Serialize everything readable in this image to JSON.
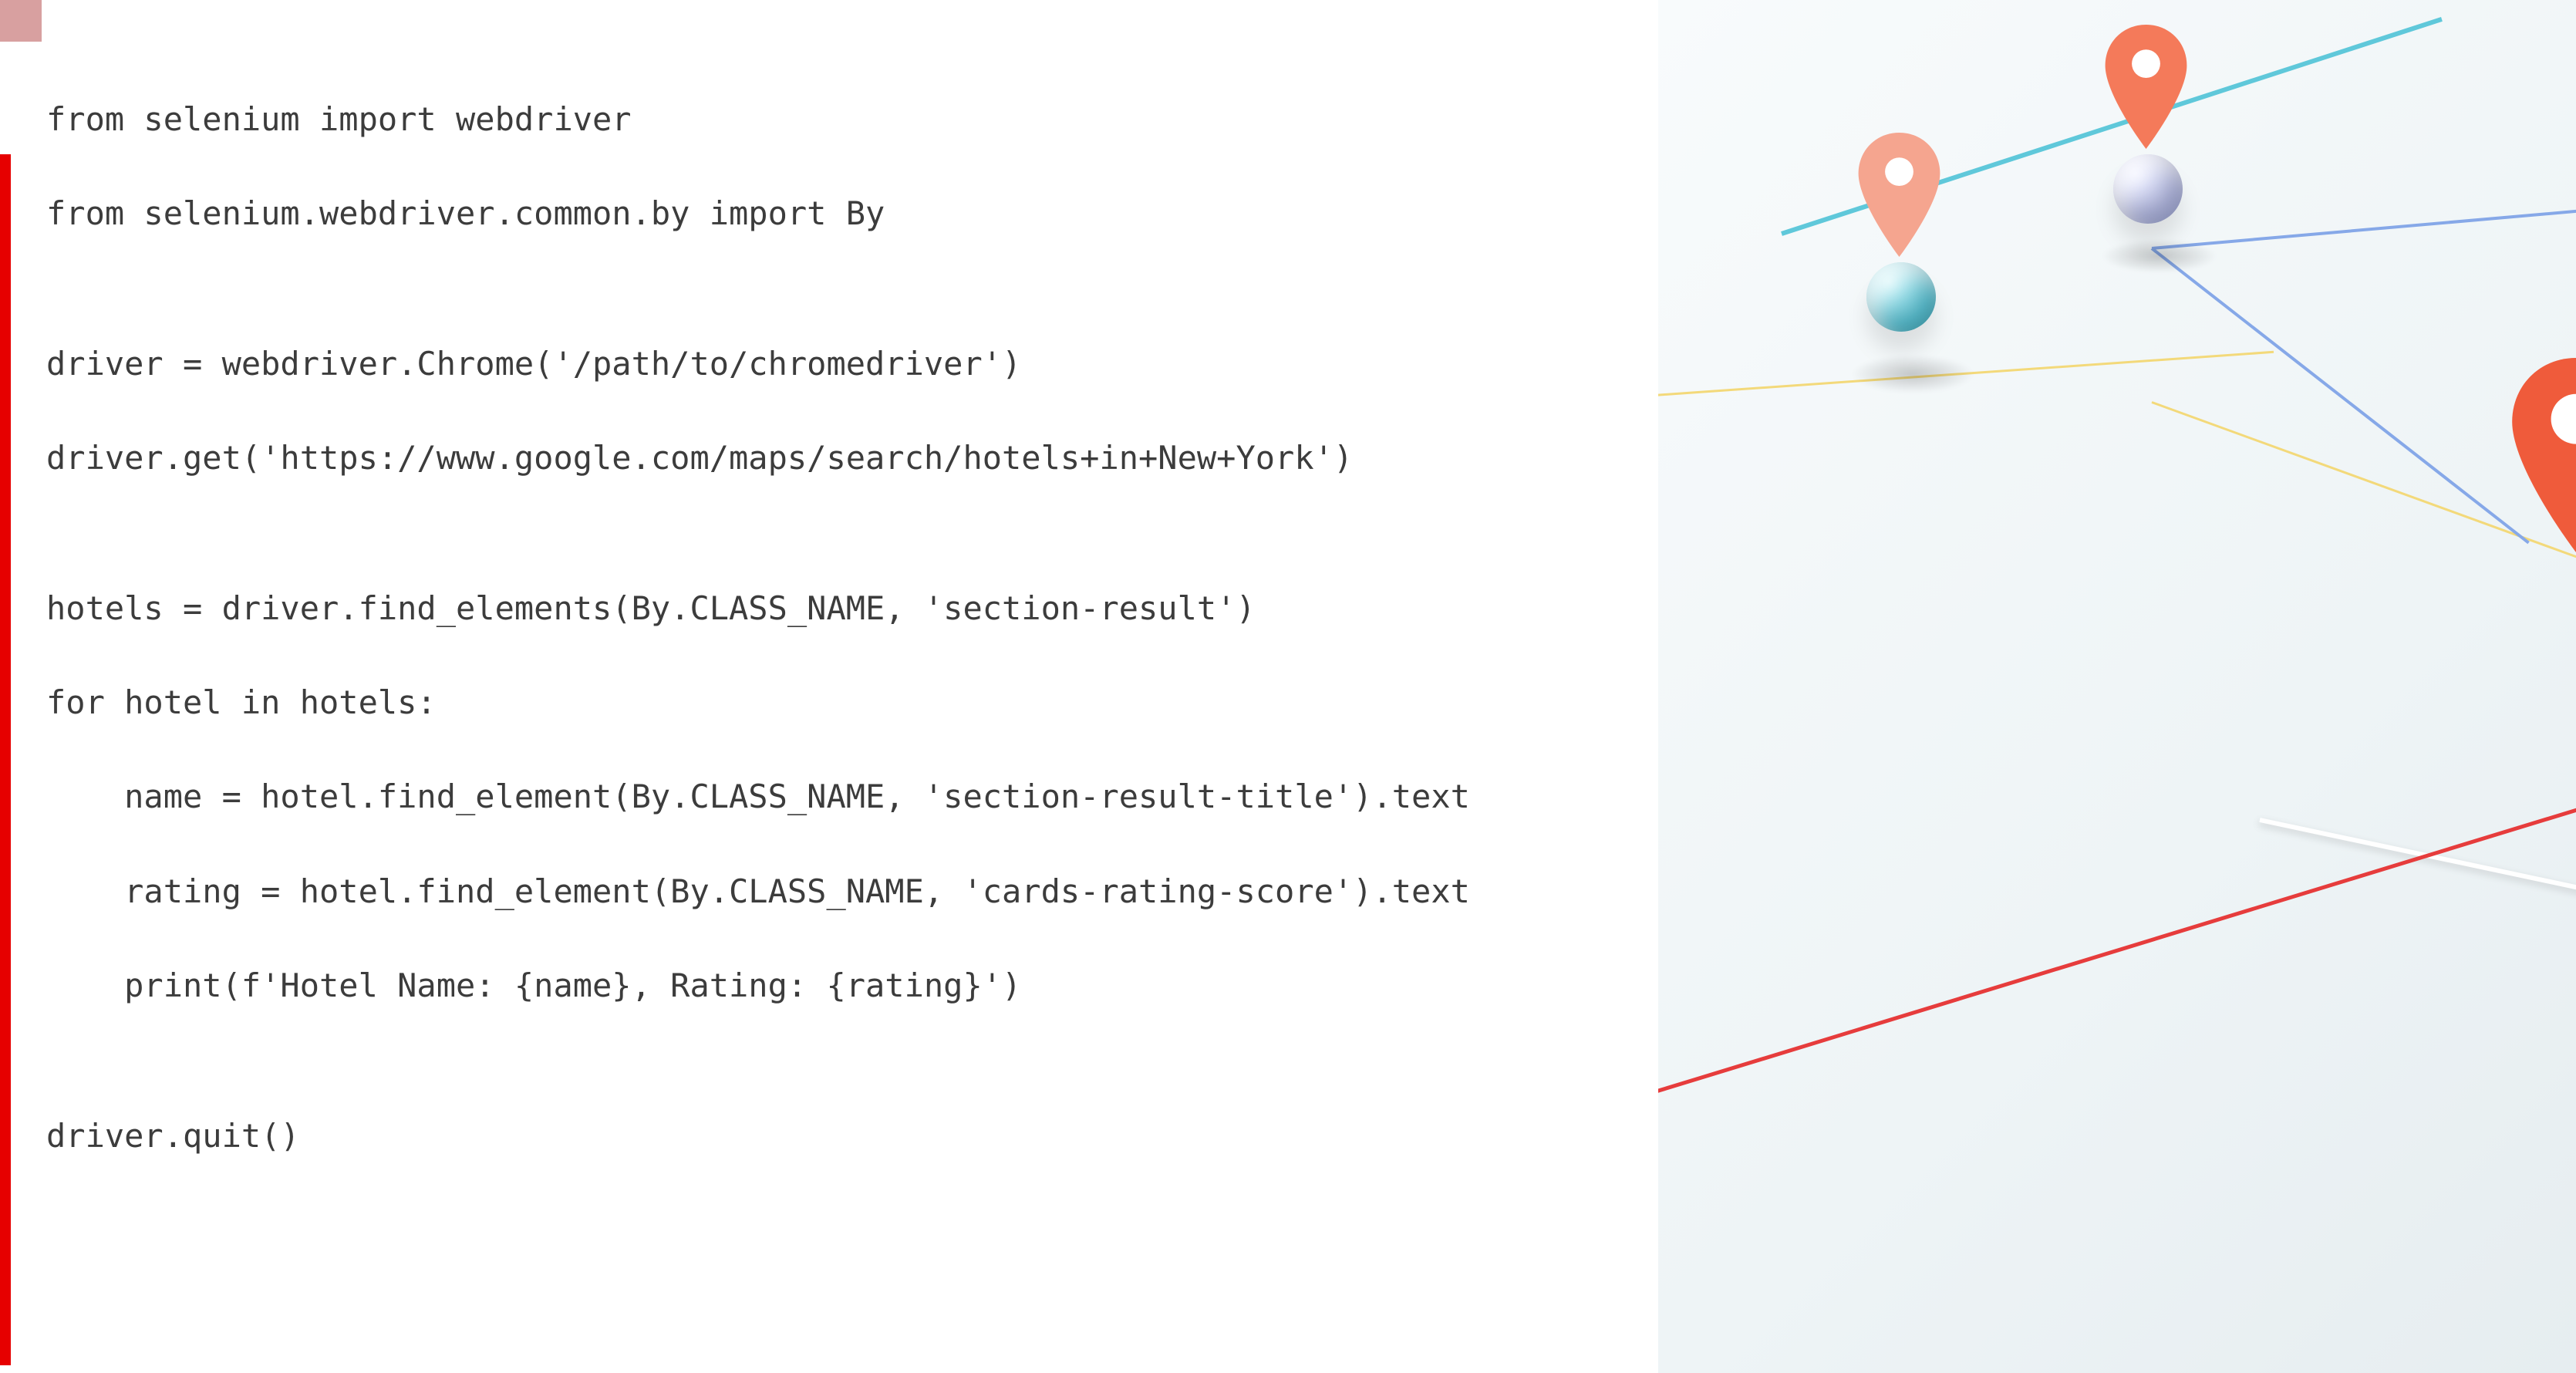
{
  "code": {
    "lines": [
      "from selenium import webdriver",
      "from selenium.webdriver.common.by import By",
      "",
      "driver = webdriver.Chrome('/path/to/chromedriver')",
      "driver.get('https://www.google.com/maps/search/hotels+in+New+York')",
      "",
      "hotels = driver.find_elements(By.CLASS_NAME, 'section-result')",
      "for hotel in hotels:",
      "    name = hotel.find_element(By.CLASS_NAME, 'section-result-title').text",
      "    rating = hotel.find_element(By.CLASS_NAME, 'cards-rating-score').text",
      "    print(f'Hotel Name: {name}, Rating: {rating}')",
      "",
      "driver.quit()"
    ]
  },
  "colors": {
    "accent_red": "#e60000",
    "swatch_pink": "#d8a0a0",
    "marker_fill": "#f47a5a",
    "marker_fill_light": "#f5a58f"
  }
}
